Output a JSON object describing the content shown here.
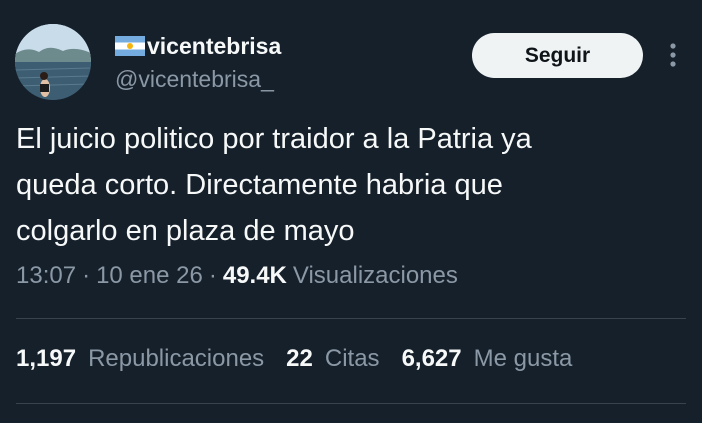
{
  "author": {
    "display_name": "vicentebrisa",
    "handle": "@vicentebrisa_",
    "flag_icon": "argentina-flag-icon",
    "avatar_icon": "lake-photo-avatar"
  },
  "follow_button": {
    "label": "Seguir"
  },
  "more_icon": "more-vertical-icon",
  "tweet": {
    "lines": [
      "El juicio politico por traidor a la Patria ya",
      "queda corto. Directamente habria que",
      "colgarlo en plaza de mayo"
    ]
  },
  "meta": {
    "time": "13:07",
    "date": "10 ene 26",
    "separator": "·",
    "views_count": "49.4K",
    "views_label": "Visualizaciones"
  },
  "stats": {
    "reposts_count": "1,197",
    "reposts_label": "Republicaciones",
    "quotes_count": "22",
    "quotes_label": "Citas",
    "likes_count": "6,627",
    "likes_label": "Me gusta"
  },
  "colors": {
    "background": "#15202b",
    "text_primary": "#f7f9f9",
    "text_secondary": "#8b98a5",
    "divider": "#38444d",
    "button_bg": "#eff3f4"
  }
}
